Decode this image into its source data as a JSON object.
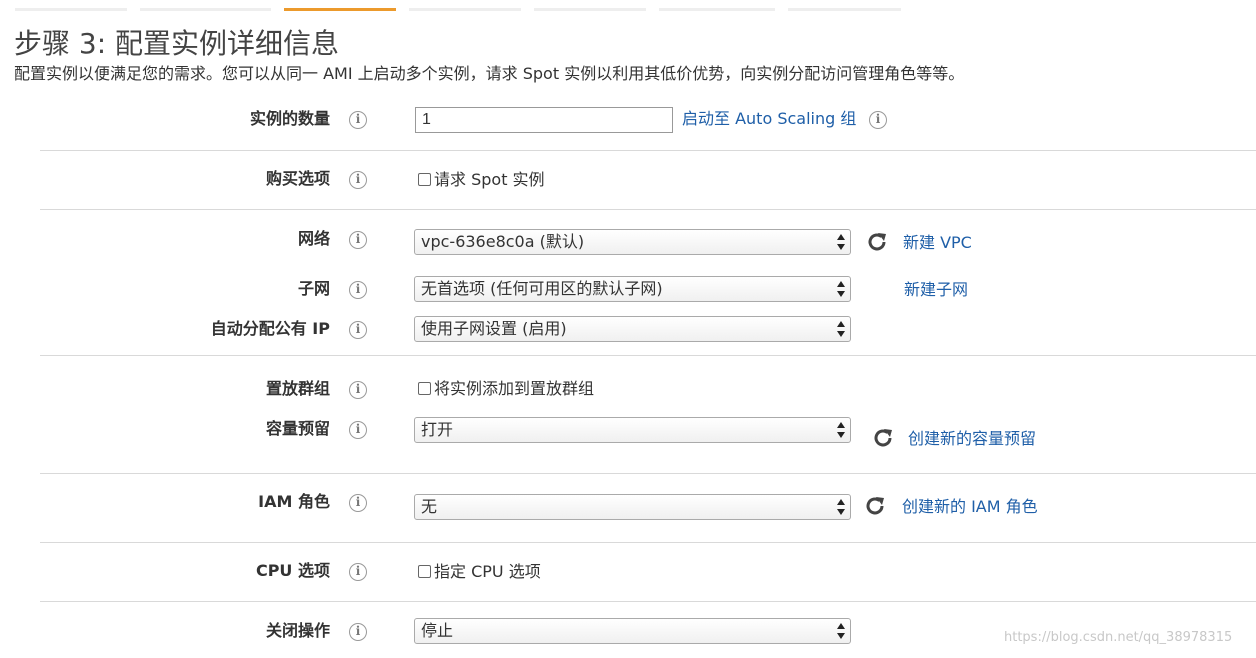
{
  "wizard": {
    "tab_count": 7,
    "active_tab_index": 2
  },
  "page": {
    "title": "步骤 3: 配置实例详细信息",
    "subtitle": "配置实例以便满足您的需求。您可以从同一 AMI 上启动多个实例，请求 Spot 实例以利用其低价优势，向实例分配访问管理角色等等。"
  },
  "info_glyph": "i",
  "fields": {
    "instance_count": {
      "label": "实例的数量",
      "value": "1",
      "link": "启动至 Auto Scaling 组"
    },
    "purchase_option": {
      "label": "购买选项",
      "checkbox_label": "请求 Spot 实例",
      "checked": false
    },
    "network": {
      "label": "网络",
      "value": "vpc-636e8c0a (默认)",
      "link": "新建 VPC"
    },
    "subnet": {
      "label": "子网",
      "value": "无首选项 (任何可用区的默认子网)",
      "link": "新建子网"
    },
    "auto_assign_ip": {
      "label": "自动分配公有 IP",
      "value": "使用子网设置 (启用)"
    },
    "placement_group": {
      "label": "置放群组",
      "checkbox_label": "将实例添加到置放群组",
      "checked": false
    },
    "capacity_reservation": {
      "label": "容量预留",
      "value": "打开",
      "link": "创建新的容量预留"
    },
    "iam_role": {
      "label": "IAM 角色",
      "value": "无",
      "link": "创建新的 IAM 角色"
    },
    "cpu_options": {
      "label": "CPU 选项",
      "checkbox_label": "指定 CPU 选项",
      "checked": false
    },
    "shutdown_behavior": {
      "label": "关闭操作",
      "value": "停止"
    }
  },
  "colors": {
    "accent": "#ec9a2c",
    "link": "#1f5fa8"
  },
  "watermark": "https://blog.csdn.net/qq_38978315"
}
